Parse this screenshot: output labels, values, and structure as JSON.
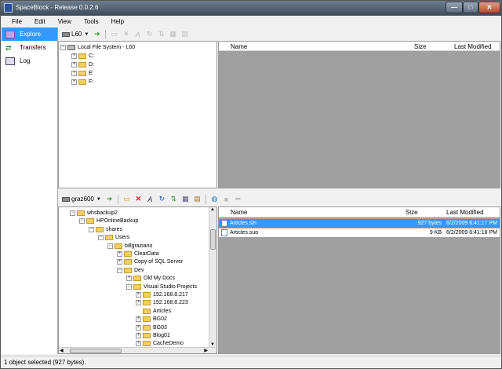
{
  "window": {
    "title": "SpaceBlock - Release 0.0.2.6"
  },
  "menu": [
    "File",
    "Edit",
    "View",
    "Tools",
    "Help"
  ],
  "nav": [
    {
      "label": "Explore",
      "active": true
    },
    {
      "label": "Transfers",
      "active": false
    },
    {
      "label": "Log",
      "active": false
    }
  ],
  "top_pane": {
    "drive": "L60",
    "tree": {
      "root": "Local File System - L60",
      "drives": [
        "C:",
        "D:",
        "E:",
        "F:"
      ]
    },
    "columns": {
      "name": "Name",
      "size": "Size",
      "modified": "Last Modified"
    }
  },
  "bottom_pane": {
    "drive": "graz600",
    "tree": [
      "whsbackup2",
      "HPOnlineBackup",
      "shares",
      "Users",
      "billgraziano",
      "ClearData",
      "Copy of SQL Server",
      "Dev",
      "Old My Docs",
      "Visual Studio Projects",
      "192.168.8.217",
      "192.168.8.223",
      "Articles",
      "BG02",
      "BG03",
      "Blog01",
      "CacheDemo"
    ],
    "columns": {
      "name": "Name",
      "size": "Size",
      "modified": "Last Modified"
    },
    "files": [
      {
        "name": "Articles.sln",
        "size": "927 bytes",
        "modified": "6/2/2009 6:41:17 PM",
        "selected": true
      },
      {
        "name": "Articles.suo",
        "size": "9 KB",
        "modified": "6/2/2009 6:41:18 PM",
        "selected": false
      }
    ]
  },
  "status": "1 object selected (927 bytes).",
  "colors": {
    "selection": "#3399ff",
    "empty_list": "#a0a0a0",
    "folder": "#f3cf62"
  }
}
